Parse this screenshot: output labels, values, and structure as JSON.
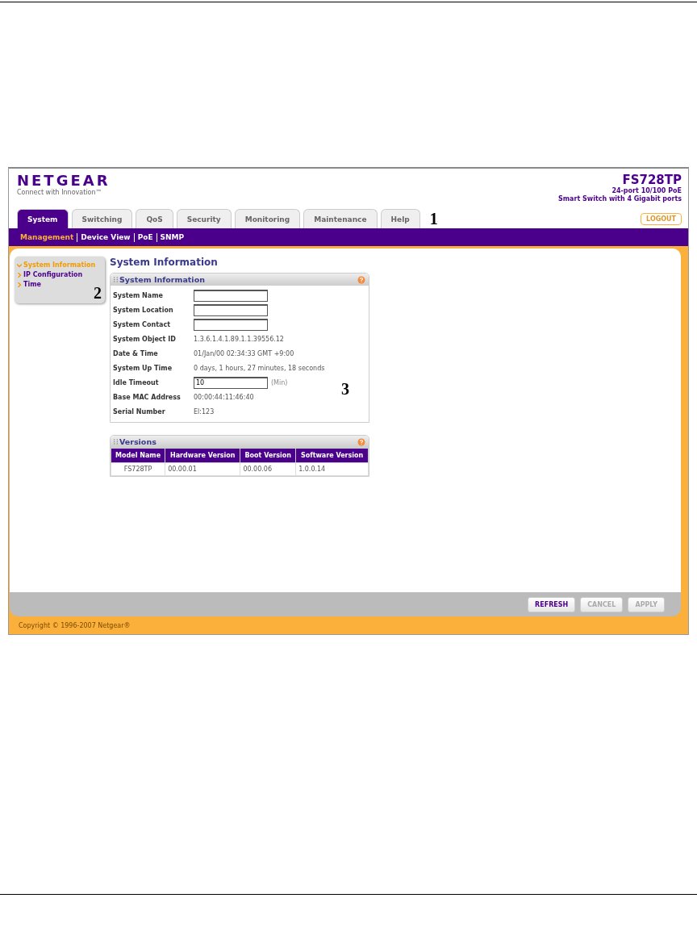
{
  "logo": {
    "brand": "NETGEAR",
    "tagline": "Connect with Innovation™"
  },
  "product": {
    "model": "FS728TP",
    "line_1": "24-port 10/100 PoE",
    "line_2": "Smart Switch with 4 Gigabit ports"
  },
  "tabs": [
    {
      "label": "System",
      "selected": true
    },
    {
      "label": "Switching",
      "selected": false
    },
    {
      "label": "QoS",
      "selected": false
    },
    {
      "label": "Security",
      "selected": false
    },
    {
      "label": "Monitoring",
      "selected": false
    },
    {
      "label": "Maintenance",
      "selected": false
    },
    {
      "label": "Help",
      "selected": false
    }
  ],
  "logout": "LOGOUT",
  "subnav": [
    {
      "label": "Management",
      "selected": true
    },
    {
      "label": "Device View",
      "selected": false
    },
    {
      "label": "PoE",
      "selected": false
    },
    {
      "label": "SNMP",
      "selected": false
    }
  ],
  "sidebar": {
    "items": [
      {
        "label": "System Information",
        "selected": true
      },
      {
        "label": "IP Configuration",
        "selected": false
      },
      {
        "label": "Time",
        "selected": false
      }
    ]
  },
  "page_title": "System Information",
  "info_panel": {
    "title": "System Information",
    "rows": [
      {
        "kind": "input",
        "label": "System Name"
      },
      {
        "kind": "input",
        "label": "System Location"
      },
      {
        "kind": "input",
        "label": "System Contact"
      },
      {
        "kind": "text",
        "label": "System Object ID",
        "value": "1.3.6.1.4.1.89.1.1.39556.12"
      },
      {
        "kind": "text",
        "label": "Date & Time",
        "value": "01/Jan/00  02:34:33 GMT +9:00"
      },
      {
        "kind": "text",
        "label": "System Up Time",
        "value": "0 days, 1 hours, 27 minutes, 18 seconds"
      },
      {
        "kind": "input",
        "label": "Idle Timeout",
        "value": "10",
        "unit": "(Min)"
      },
      {
        "kind": "text",
        "label": "Base MAC Address",
        "value": "00:00:44:11:46:40"
      },
      {
        "kind": "text",
        "label": "Serial Number",
        "value": "El:123"
      }
    ]
  },
  "versions": {
    "title": "Versions",
    "columns": [
      "Model Name",
      "Hardware Version",
      "Boot Version",
      "Software Version"
    ],
    "rows": [
      [
        "FS728TP",
        "00.00.01",
        "00.00.06",
        "1.0.0.14"
      ]
    ]
  },
  "buttons": [
    {
      "label": "REFRESH",
      "disabled": false
    },
    {
      "label": "CANCEL",
      "disabled": true
    },
    {
      "label": "APPLY",
      "disabled": true
    }
  ],
  "copyright": "Copyright © 1996-2007 Netgear®",
  "callouts": [
    "1",
    "2",
    "3"
  ]
}
